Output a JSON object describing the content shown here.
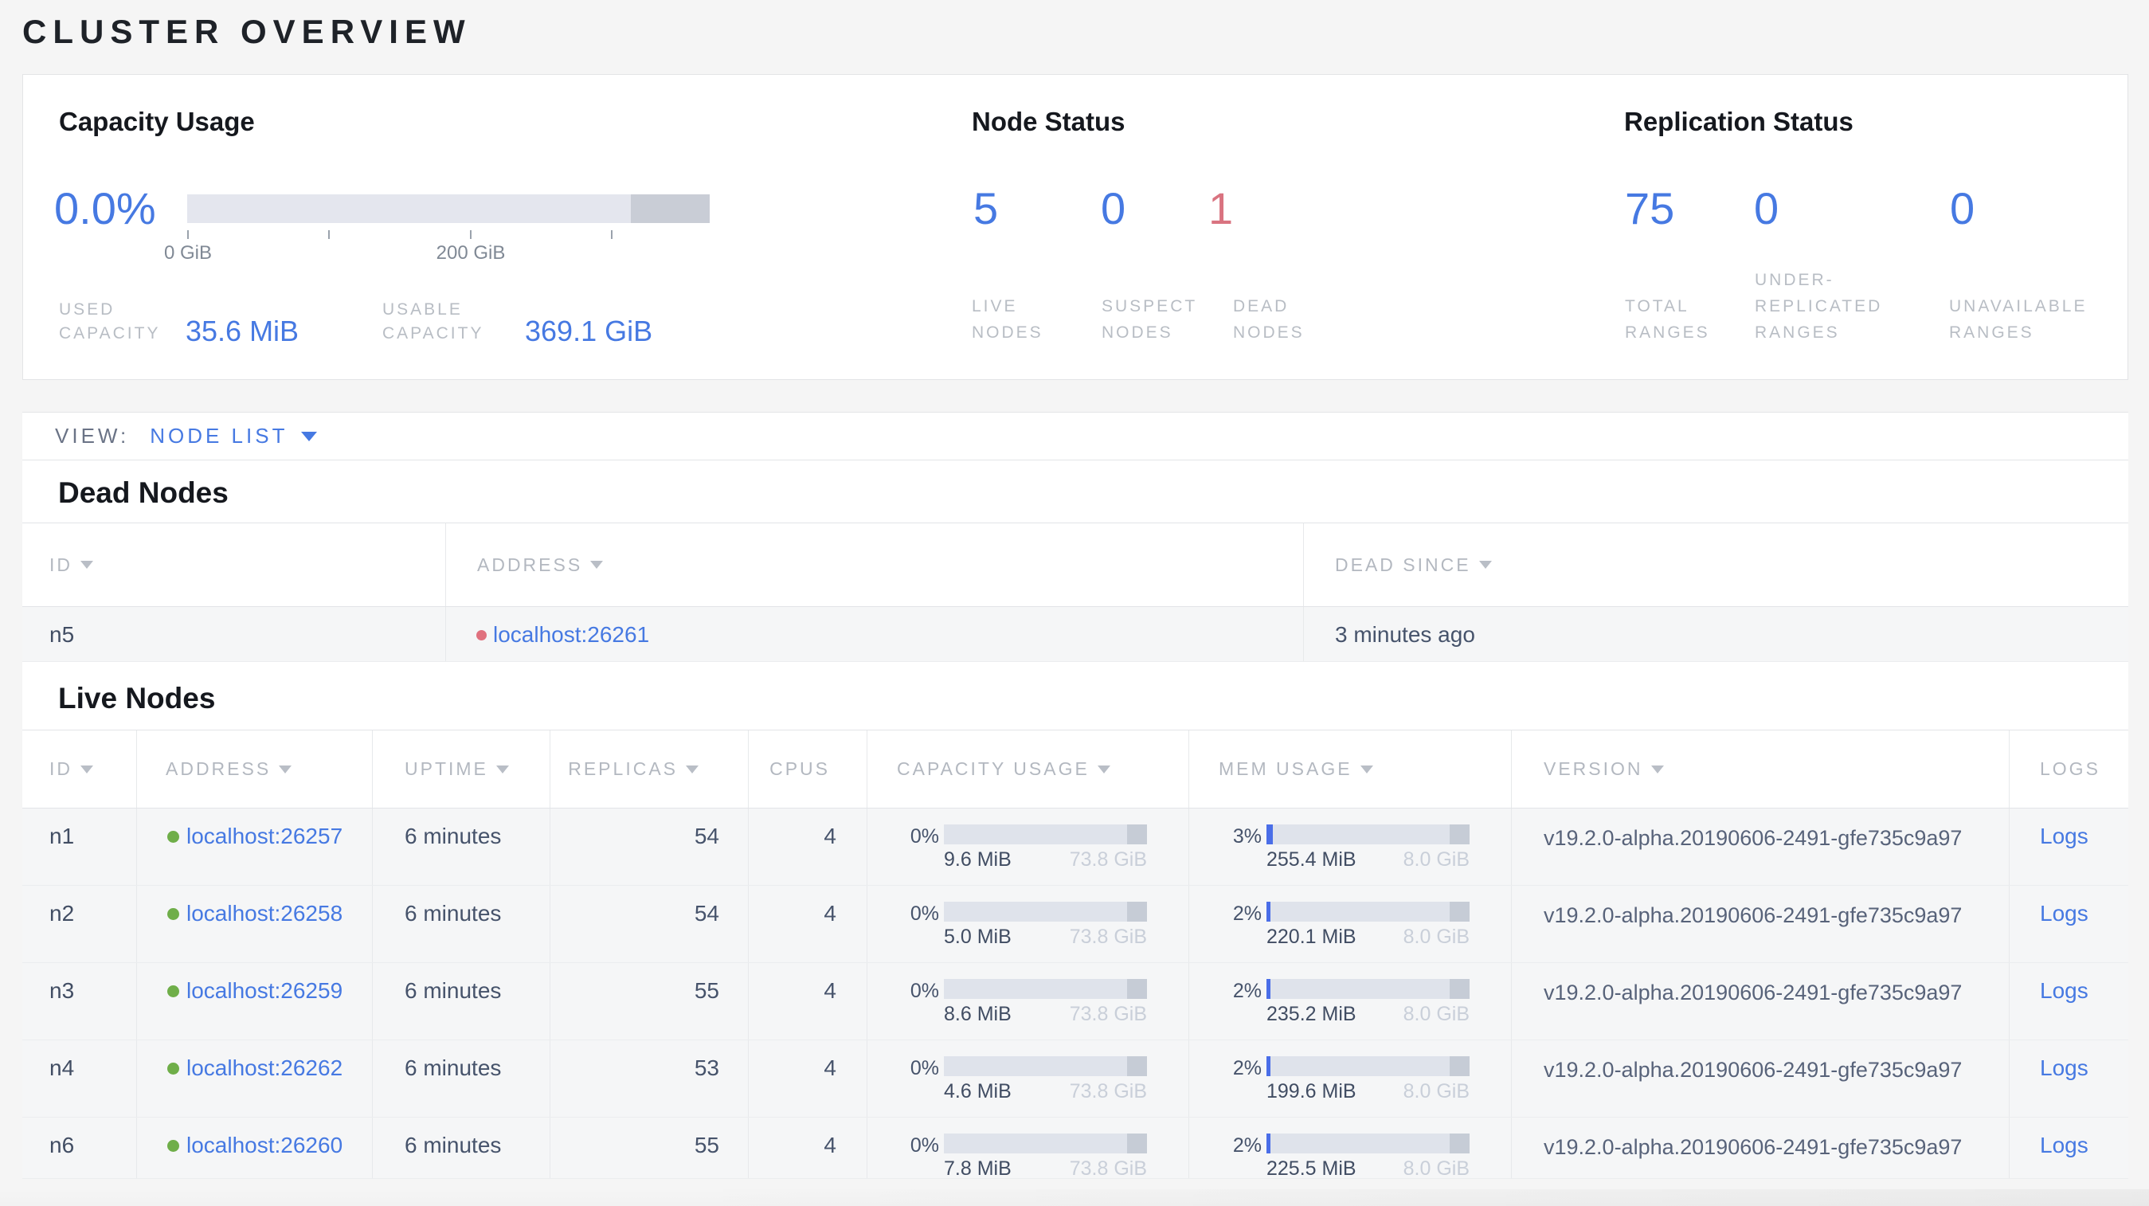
{
  "page_title": "CLUSTER OVERVIEW",
  "colors": {
    "accent_blue": "#4679e2",
    "danger_red": "#d97380",
    "live_green": "#6fae49",
    "bar_fill": "#4a6ee8"
  },
  "summary": {
    "capacity": {
      "title": "Capacity Usage",
      "percent": "0.0%",
      "bar": {
        "tick_labels": [
          "0 GiB",
          "200 GiB"
        ],
        "usable_gib": 369.1,
        "dark_from_gib": 313
      },
      "stats": [
        {
          "label": "USED\nCAPACITY",
          "value": "35.6 MiB"
        },
        {
          "label": "USABLE\nCAPACITY",
          "value": "369.1 GiB"
        }
      ]
    },
    "node_status": {
      "title": "Node Status",
      "metrics": [
        {
          "value": "5",
          "label": "LIVE\nNODES"
        },
        {
          "value": "0",
          "label": "SUSPECT\nNODES"
        },
        {
          "value": "1",
          "label": "DEAD\nNODES"
        }
      ]
    },
    "replication": {
      "title": "Replication Status",
      "metrics": [
        {
          "value": "75",
          "label": "TOTAL\nRANGES"
        },
        {
          "value": "0",
          "label": "UNDER-\nREPLICATED\nRANGES"
        },
        {
          "value": "0",
          "label": "UNAVAILABLE\nRANGES"
        }
      ]
    }
  },
  "view_bar": {
    "label": "VIEW:",
    "selected": "NODE LIST"
  },
  "dead_nodes": {
    "title": "Dead Nodes",
    "columns": [
      {
        "label": "ID",
        "sort": true
      },
      {
        "label": "ADDRESS",
        "sort": true
      },
      {
        "label": "DEAD SINCE",
        "sort": true
      }
    ],
    "rows": [
      {
        "id": "n5",
        "address": "localhost:26261",
        "dead_since": "3 minutes ago"
      }
    ]
  },
  "live_nodes": {
    "title": "Live Nodes",
    "columns": [
      {
        "label": "ID",
        "sort": true
      },
      {
        "label": "ADDRESS",
        "sort": true
      },
      {
        "label": "UPTIME",
        "sort": true
      },
      {
        "label": "REPLICAS",
        "sort": true
      },
      {
        "label": "CPUS",
        "sort": false
      },
      {
        "label": "CAPACITY USAGE",
        "sort": true
      },
      {
        "label": "MEM USAGE",
        "sort": true
      },
      {
        "label": "VERSION",
        "sort": true
      },
      {
        "label": "LOGS",
        "sort": false
      }
    ],
    "rows": [
      {
        "id": "n1",
        "address": "localhost:26257",
        "uptime": "6 minutes",
        "replicas": "54",
        "cpus": "4",
        "capacity": {
          "percent": "0%",
          "pct": 0,
          "used": "9.6 MiB",
          "total": "73.8 GiB"
        },
        "mem": {
          "percent": "3%",
          "pct": 3,
          "used": "255.4 MiB",
          "total": "8.0 GiB"
        },
        "version": "v19.2.0-alpha.20190606-2491-gfe735c9a97",
        "logs": "Logs"
      },
      {
        "id": "n2",
        "address": "localhost:26258",
        "uptime": "6 minutes",
        "replicas": "54",
        "cpus": "4",
        "capacity": {
          "percent": "0%",
          "pct": 0,
          "used": "5.0 MiB",
          "total": "73.8 GiB"
        },
        "mem": {
          "percent": "2%",
          "pct": 2,
          "used": "220.1 MiB",
          "total": "8.0 GiB"
        },
        "version": "v19.2.0-alpha.20190606-2491-gfe735c9a97",
        "logs": "Logs"
      },
      {
        "id": "n3",
        "address": "localhost:26259",
        "uptime": "6 minutes",
        "replicas": "55",
        "cpus": "4",
        "capacity": {
          "percent": "0%",
          "pct": 0,
          "used": "8.6 MiB",
          "total": "73.8 GiB"
        },
        "mem": {
          "percent": "2%",
          "pct": 2,
          "used": "235.2 MiB",
          "total": "8.0 GiB"
        },
        "version": "v19.2.0-alpha.20190606-2491-gfe735c9a97",
        "logs": "Logs"
      },
      {
        "id": "n4",
        "address": "localhost:26262",
        "uptime": "6 minutes",
        "replicas": "53",
        "cpus": "4",
        "capacity": {
          "percent": "0%",
          "pct": 0,
          "used": "4.6 MiB",
          "total": "73.8 GiB"
        },
        "mem": {
          "percent": "2%",
          "pct": 2,
          "used": "199.6 MiB",
          "total": "8.0 GiB"
        },
        "version": "v19.2.0-alpha.20190606-2491-gfe735c9a97",
        "logs": "Logs"
      },
      {
        "id": "n6",
        "address": "localhost:26260",
        "uptime": "6 minutes",
        "replicas": "55",
        "cpus": "4",
        "capacity": {
          "percent": "0%",
          "pct": 0,
          "used": "7.8 MiB",
          "total": "73.8 GiB"
        },
        "mem": {
          "percent": "2%",
          "pct": 2,
          "used": "225.5 MiB",
          "total": "8.0 GiB"
        },
        "version": "v19.2.0-alpha.20190606-2491-gfe735c9a97",
        "logs": "Logs"
      }
    ]
  }
}
